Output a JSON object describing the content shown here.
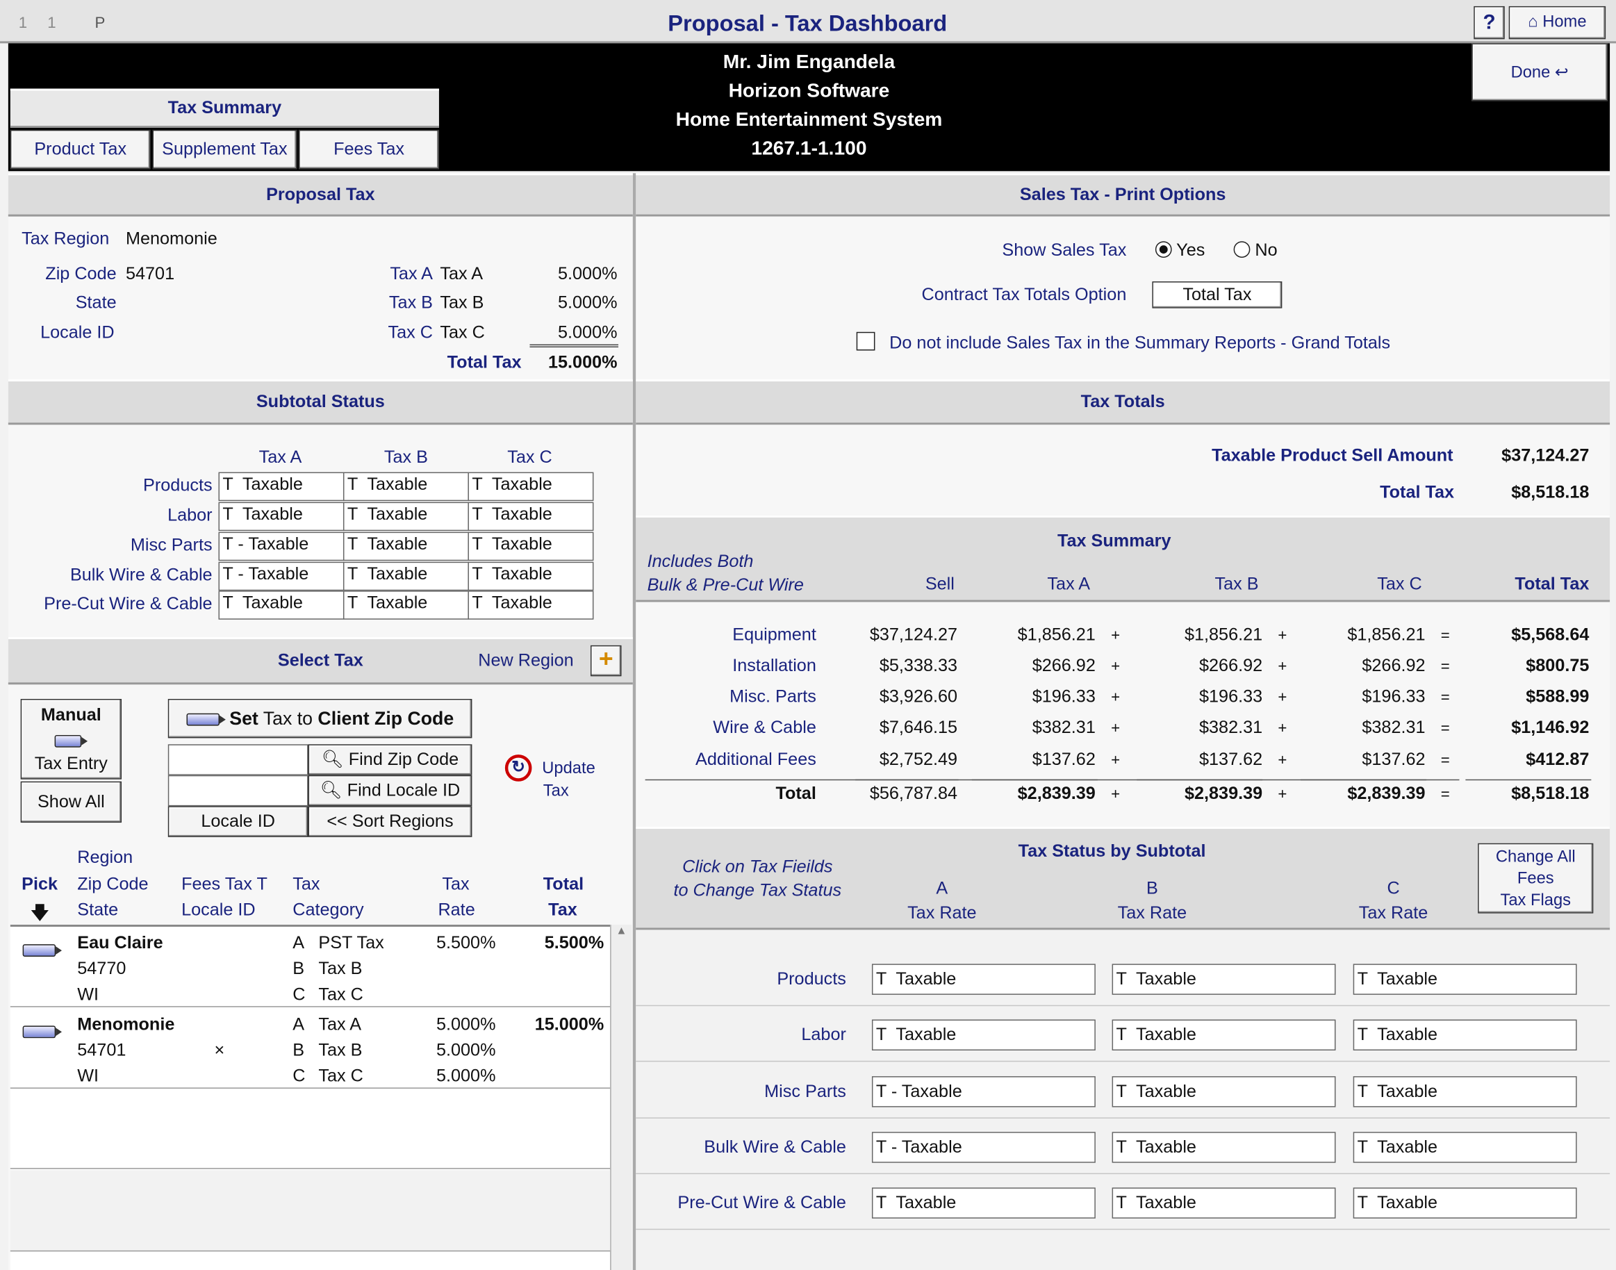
{
  "titlebar": {
    "left1": "1",
    "left2": "1",
    "left3": "P",
    "title": "Proposal - Tax Dashboard",
    "help": "?",
    "home": "Home"
  },
  "header": {
    "line1": "Mr. Jim Engandela",
    "line2": "Horizon Software",
    "line3": "Home Entertainment System",
    "line4": "1267.1-1.100",
    "done": "Done"
  },
  "tax_summary_tabs": {
    "title": "Tax Summary",
    "tabs": [
      "Product Tax",
      "Supplement Tax",
      "Fees Tax"
    ]
  },
  "proposal_tax": {
    "title": "Proposal Tax",
    "tax_region_label": "Tax Region",
    "tax_region": "Menomonie",
    "zip_label": "Zip Code",
    "zip": "54701",
    "state_label": "State",
    "locale_label": "Locale ID",
    "rates": [
      {
        "code": "Tax A",
        "name": "Tax A",
        "rate": "5.000%"
      },
      {
        "code": "Tax B",
        "name": "Tax B",
        "rate": "5.000%"
      },
      {
        "code": "Tax C",
        "name": "Tax C",
        "rate": "5.000%"
      }
    ],
    "total_label": "Total Tax",
    "total_rate": "15.000%"
  },
  "subtotal_status": {
    "title": "Subtotal Status",
    "cols": [
      "Tax A",
      "Tax B",
      "Tax C"
    ],
    "rows": [
      {
        "label": "Products",
        "a": "T  Taxable",
        "b": "T  Taxable",
        "c": "T  Taxable"
      },
      {
        "label": "Labor",
        "a": "T  Taxable",
        "b": "T  Taxable",
        "c": "T  Taxable"
      },
      {
        "label": "Misc Parts",
        "a": "T - Taxable",
        "b": "T  Taxable",
        "c": "T  Taxable"
      },
      {
        "label": "Bulk Wire & Cable",
        "a": "T - Taxable",
        "b": "T  Taxable",
        "c": "T  Taxable"
      },
      {
        "label": "Pre-Cut Wire & Cable",
        "a": "T  Taxable",
        "b": "T  Taxable",
        "c": "T  Taxable"
      }
    ]
  },
  "select_tax": {
    "title": "Select Tax",
    "new_region": "New Region",
    "manual": "Manual",
    "tax_entry": "Tax Entry",
    "show_all": "Show All",
    "set_tax_prefix": "Set",
    "set_tax_mid": " Tax to ",
    "set_tax_suffix": "Client Zip Code",
    "find_zip": "Find Zip Code",
    "find_locale": "Find Locale ID",
    "locale_id": "Locale ID",
    "sort_regions": "<< Sort Regions",
    "update": "Update",
    "update2": "Tax",
    "col_pick": "Pick",
    "col_region": "Region",
    "col_zip": "Zip Code",
    "col_state": "State",
    "col_fees": "Fees Tax T",
    "col_locale": "Locale ID",
    "col_tax": "Tax",
    "col_category": "Category",
    "col_rate1": "Tax",
    "col_rate2": "Rate",
    "col_total1": "Total",
    "col_total2": "Tax",
    "regions": [
      {
        "name": "Eau Claire",
        "zip": "54770",
        "state": "WI",
        "fees": "",
        "total": "5.500%",
        "lines": [
          {
            "k": "A",
            "n": "PST Tax",
            "r": "5.500%"
          },
          {
            "k": "B",
            "n": "Tax B",
            "r": ""
          },
          {
            "k": "C",
            "n": "Tax C",
            "r": ""
          }
        ]
      },
      {
        "name": "Menomonie",
        "zip": "54701",
        "state": "WI",
        "fees": "×",
        "total": "15.000%",
        "lines": [
          {
            "k": "A",
            "n": "Tax A",
            "r": "5.000%"
          },
          {
            "k": "B",
            "n": "Tax B",
            "r": "5.000%"
          },
          {
            "k": "C",
            "n": "Tax C",
            "r": "5.000%"
          }
        ]
      }
    ]
  },
  "print_options": {
    "title": "Sales Tax - Print Options",
    "show_label": "Show Sales Tax",
    "yes": "Yes",
    "no": "No",
    "selected": "Yes",
    "contract_label": "Contract Tax Totals Option",
    "contract_value": "Total Tax",
    "exclude_label": "Do not include Sales Tax in the Summary Reports - Grand Totals",
    "exclude_checked": false
  },
  "tax_totals": {
    "title": "Tax Totals",
    "sell_label": "Taxable Product Sell Amount",
    "sell": "$37,124.27",
    "total_label": "Total Tax",
    "total": "$8,518.18"
  },
  "summary": {
    "title": "Tax Summary",
    "note1": "Includes Both",
    "note2": "Bulk & Pre-Cut Wire",
    "cols": [
      "Sell",
      "Tax A",
      "Tax B",
      "Tax C",
      "Total Tax"
    ],
    "rows": [
      {
        "label": "Equipment",
        "sell": "$37,124.27",
        "a": "$1,856.21",
        "b": "$1,856.21",
        "c": "$1,856.21",
        "t": "$5,568.64"
      },
      {
        "label": "Installation",
        "sell": "$5,338.33",
        "a": "$266.92",
        "b": "$266.92",
        "c": "$266.92",
        "t": "$800.75"
      },
      {
        "label": "Misc. Parts",
        "sell": "$3,926.60",
        "a": "$196.33",
        "b": "$196.33",
        "c": "$196.33",
        "t": "$588.99"
      },
      {
        "label": "Wire & Cable",
        "sell": "$7,646.15",
        "a": "$382.31",
        "b": "$382.31",
        "c": "$382.31",
        "t": "$1,146.92"
      },
      {
        "label": "Additional Fees",
        "sell": "$2,752.49",
        "a": "$137.62",
        "b": "$137.62",
        "c": "$137.62",
        "t": "$412.87"
      }
    ],
    "total": {
      "label": "Total",
      "sell": "$56,787.84",
      "a": "$2,839.39",
      "b": "$2,839.39",
      "c": "$2,839.39",
      "t": "$8,518.18"
    },
    "plus": "+",
    "eq": "="
  },
  "status_by_subtotal": {
    "title": "Tax Status by Subtotal",
    "note1": "Click on Tax Fieilds",
    "note2": "to Change Tax Status",
    "col_a": "A",
    "col_b": "B",
    "col_c": "C",
    "rate": "Tax Rate",
    "change_all": [
      "Change All",
      "Fees",
      "Tax Flags"
    ],
    "rows": [
      {
        "label": "Products",
        "a": "T  Taxable",
        "b": "T  Taxable",
        "c": "T  Taxable"
      },
      {
        "label": "Labor",
        "a": "T  Taxable",
        "b": "T  Taxable",
        "c": "T  Taxable"
      },
      {
        "label": "Misc Parts",
        "a": "T - Taxable",
        "b": "T  Taxable",
        "c": "T  Taxable"
      },
      {
        "label": "Bulk Wire & Cable",
        "a": "T - Taxable",
        "b": "T  Taxable",
        "c": "T  Taxable"
      },
      {
        "label": "Pre-Cut Wire & Cable",
        "a": "T  Taxable",
        "b": "T  Taxable",
        "c": "T  Taxable"
      }
    ]
  }
}
